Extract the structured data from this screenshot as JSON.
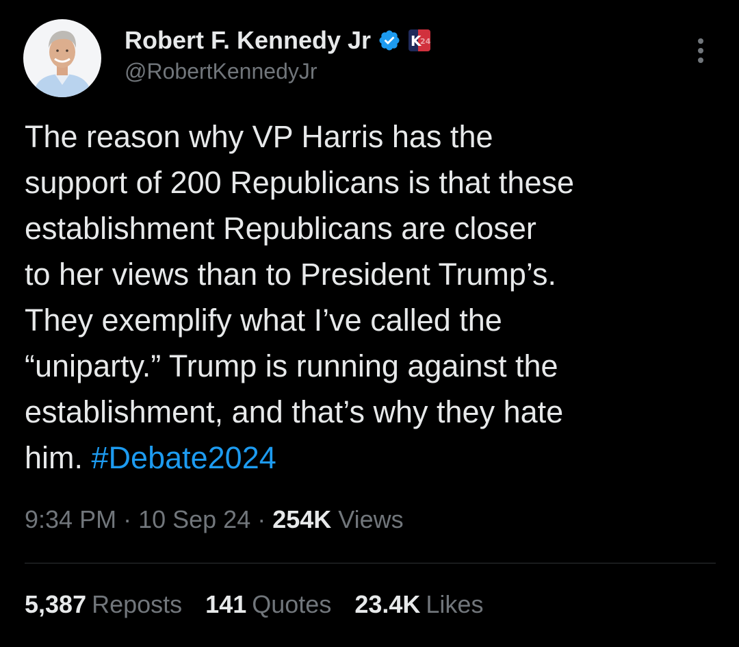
{
  "author": {
    "display_name": "Robert F. Kennedy Jr",
    "handle": "@RobertKennedyJr",
    "verified_icon": "verified-badge-icon",
    "affiliate_badge_text": "K24",
    "verified_color": "#1d9bf0"
  },
  "tweet": {
    "lines": [
      "The reason why VP Harris has the",
      "support of 200 Republicans is that these",
      "establishment Republicans are closer",
      "to her views than to President Trump’s.",
      "They exemplify what I’ve called the",
      "“uniparty.” Trump is running against the",
      "establishment, and that’s why they hate"
    ],
    "last_line_prefix": "him. ",
    "hashtag": "#Debate2024",
    "hashtag_color": "#1d9bf0"
  },
  "meta": {
    "time": "9:34 PM",
    "separator": " · ",
    "date": "10 Sep 24",
    "views_count": "254K",
    "views_label": " Views"
  },
  "stats": {
    "reposts_count": "5,387",
    "reposts_label": "Reposts",
    "quotes_count": "141",
    "quotes_label": "Quotes",
    "likes_count": "23.4K",
    "likes_label": "Likes"
  },
  "colors": {
    "background": "#000000",
    "text": "#e7e9ea",
    "secondary": "#71767b",
    "divider": "#2f3336"
  }
}
